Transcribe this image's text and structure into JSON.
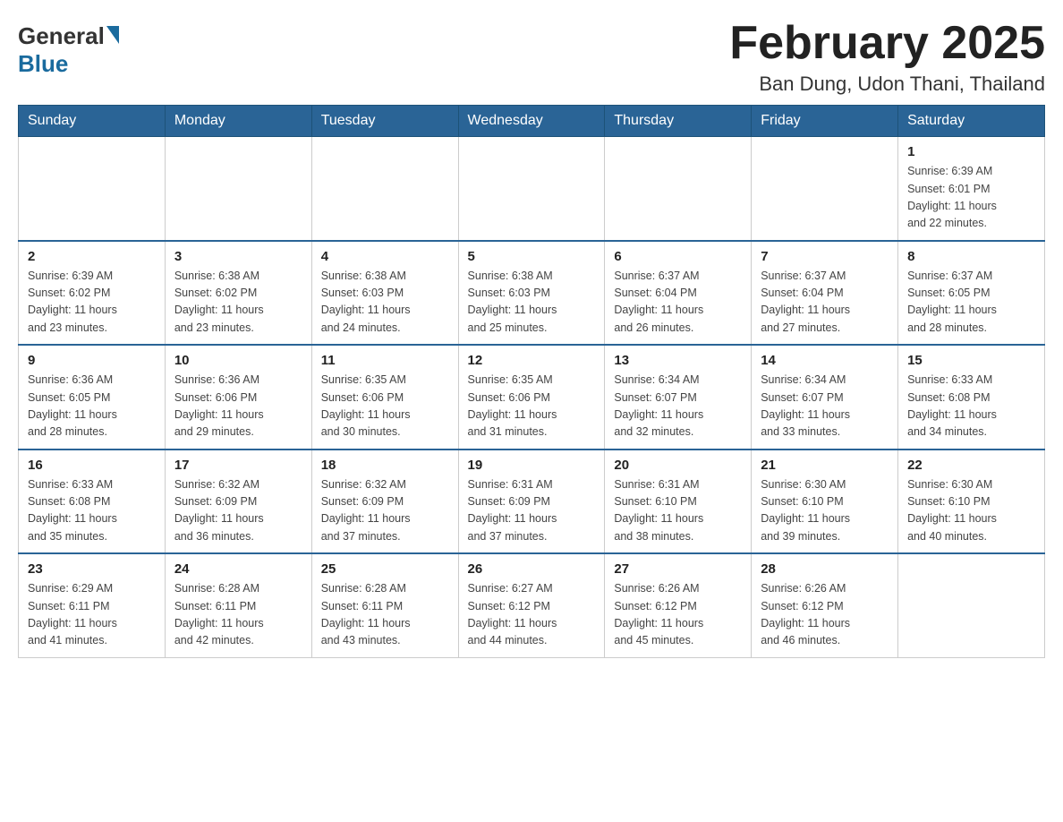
{
  "header": {
    "logo": {
      "general": "General",
      "blue": "Blue"
    },
    "title": "February 2025",
    "location": "Ban Dung, Udon Thani, Thailand"
  },
  "days_of_week": [
    "Sunday",
    "Monday",
    "Tuesday",
    "Wednesday",
    "Thursday",
    "Friday",
    "Saturday"
  ],
  "weeks": [
    {
      "days": [
        {
          "date": "",
          "info": ""
        },
        {
          "date": "",
          "info": ""
        },
        {
          "date": "",
          "info": ""
        },
        {
          "date": "",
          "info": ""
        },
        {
          "date": "",
          "info": ""
        },
        {
          "date": "",
          "info": ""
        },
        {
          "date": "1",
          "info": "Sunrise: 6:39 AM\nSunset: 6:01 PM\nDaylight: 11 hours\nand 22 minutes."
        }
      ]
    },
    {
      "days": [
        {
          "date": "2",
          "info": "Sunrise: 6:39 AM\nSunset: 6:02 PM\nDaylight: 11 hours\nand 23 minutes."
        },
        {
          "date": "3",
          "info": "Sunrise: 6:38 AM\nSunset: 6:02 PM\nDaylight: 11 hours\nand 23 minutes."
        },
        {
          "date": "4",
          "info": "Sunrise: 6:38 AM\nSunset: 6:03 PM\nDaylight: 11 hours\nand 24 minutes."
        },
        {
          "date": "5",
          "info": "Sunrise: 6:38 AM\nSunset: 6:03 PM\nDaylight: 11 hours\nand 25 minutes."
        },
        {
          "date": "6",
          "info": "Sunrise: 6:37 AM\nSunset: 6:04 PM\nDaylight: 11 hours\nand 26 minutes."
        },
        {
          "date": "7",
          "info": "Sunrise: 6:37 AM\nSunset: 6:04 PM\nDaylight: 11 hours\nand 27 minutes."
        },
        {
          "date": "8",
          "info": "Sunrise: 6:37 AM\nSunset: 6:05 PM\nDaylight: 11 hours\nand 28 minutes."
        }
      ]
    },
    {
      "days": [
        {
          "date": "9",
          "info": "Sunrise: 6:36 AM\nSunset: 6:05 PM\nDaylight: 11 hours\nand 28 minutes."
        },
        {
          "date": "10",
          "info": "Sunrise: 6:36 AM\nSunset: 6:06 PM\nDaylight: 11 hours\nand 29 minutes."
        },
        {
          "date": "11",
          "info": "Sunrise: 6:35 AM\nSunset: 6:06 PM\nDaylight: 11 hours\nand 30 minutes."
        },
        {
          "date": "12",
          "info": "Sunrise: 6:35 AM\nSunset: 6:06 PM\nDaylight: 11 hours\nand 31 minutes."
        },
        {
          "date": "13",
          "info": "Sunrise: 6:34 AM\nSunset: 6:07 PM\nDaylight: 11 hours\nand 32 minutes."
        },
        {
          "date": "14",
          "info": "Sunrise: 6:34 AM\nSunset: 6:07 PM\nDaylight: 11 hours\nand 33 minutes."
        },
        {
          "date": "15",
          "info": "Sunrise: 6:33 AM\nSunset: 6:08 PM\nDaylight: 11 hours\nand 34 minutes."
        }
      ]
    },
    {
      "days": [
        {
          "date": "16",
          "info": "Sunrise: 6:33 AM\nSunset: 6:08 PM\nDaylight: 11 hours\nand 35 minutes."
        },
        {
          "date": "17",
          "info": "Sunrise: 6:32 AM\nSunset: 6:09 PM\nDaylight: 11 hours\nand 36 minutes."
        },
        {
          "date": "18",
          "info": "Sunrise: 6:32 AM\nSunset: 6:09 PM\nDaylight: 11 hours\nand 37 minutes."
        },
        {
          "date": "19",
          "info": "Sunrise: 6:31 AM\nSunset: 6:09 PM\nDaylight: 11 hours\nand 37 minutes."
        },
        {
          "date": "20",
          "info": "Sunrise: 6:31 AM\nSunset: 6:10 PM\nDaylight: 11 hours\nand 38 minutes."
        },
        {
          "date": "21",
          "info": "Sunrise: 6:30 AM\nSunset: 6:10 PM\nDaylight: 11 hours\nand 39 minutes."
        },
        {
          "date": "22",
          "info": "Sunrise: 6:30 AM\nSunset: 6:10 PM\nDaylight: 11 hours\nand 40 minutes."
        }
      ]
    },
    {
      "days": [
        {
          "date": "23",
          "info": "Sunrise: 6:29 AM\nSunset: 6:11 PM\nDaylight: 11 hours\nand 41 minutes."
        },
        {
          "date": "24",
          "info": "Sunrise: 6:28 AM\nSunset: 6:11 PM\nDaylight: 11 hours\nand 42 minutes."
        },
        {
          "date": "25",
          "info": "Sunrise: 6:28 AM\nSunset: 6:11 PM\nDaylight: 11 hours\nand 43 minutes."
        },
        {
          "date": "26",
          "info": "Sunrise: 6:27 AM\nSunset: 6:12 PM\nDaylight: 11 hours\nand 44 minutes."
        },
        {
          "date": "27",
          "info": "Sunrise: 6:26 AM\nSunset: 6:12 PM\nDaylight: 11 hours\nand 45 minutes."
        },
        {
          "date": "28",
          "info": "Sunrise: 6:26 AM\nSunset: 6:12 PM\nDaylight: 11 hours\nand 46 minutes."
        },
        {
          "date": "",
          "info": ""
        }
      ]
    }
  ]
}
